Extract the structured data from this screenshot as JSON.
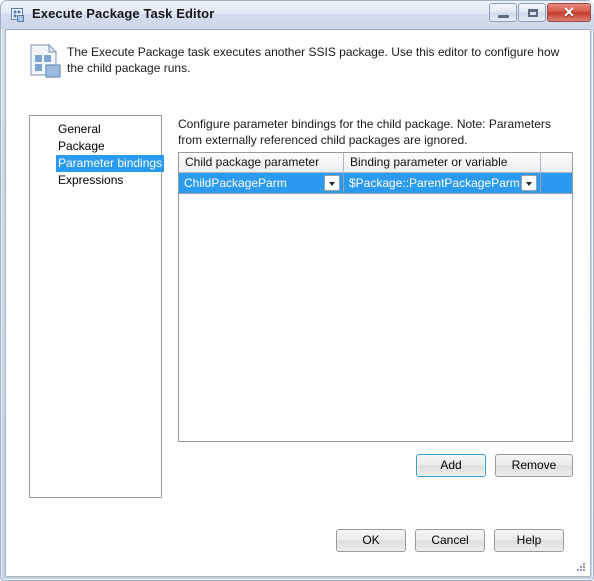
{
  "window": {
    "title": "Execute Package Task Editor",
    "title_icon": "package-document-icon",
    "controls": {
      "minimize_label": "–",
      "maximize_label": "□",
      "close_label": "✕"
    }
  },
  "banner": {
    "icon": "ssis-package-icon",
    "text": "The Execute Package task executes another SSIS package. Use this editor to configure how the child package runs."
  },
  "nav": {
    "items": [
      {
        "label": "General",
        "selected": false
      },
      {
        "label": "Package",
        "selected": false
      },
      {
        "label": "Parameter bindings",
        "selected": true
      },
      {
        "label": "Expressions",
        "selected": false
      }
    ]
  },
  "pane": {
    "description": "Configure parameter bindings for the child package. Note: Parameters from externally referenced child packages are ignored.",
    "grid": {
      "columns": [
        "Child package parameter",
        "Binding parameter or variable",
        ""
      ],
      "rows": [
        {
          "child_package_parameter": "ChildPackageParm",
          "binding_parameter_or_variable": "$Package::ParentPackageParm",
          "selected": true
        }
      ]
    },
    "grid_buttons": {
      "add_label": "Add",
      "remove_label": "Remove"
    }
  },
  "dialog_buttons": {
    "ok_label": "OK",
    "cancel_label": "Cancel",
    "help_label": "Help"
  },
  "colors": {
    "selection_blue": "#2a9bf0",
    "close_red": "#c23a2c",
    "focus_border": "#2e9ad8",
    "titlebar_top": "#eef3f9",
    "titlebar_bottom": "#cbd8ea"
  }
}
